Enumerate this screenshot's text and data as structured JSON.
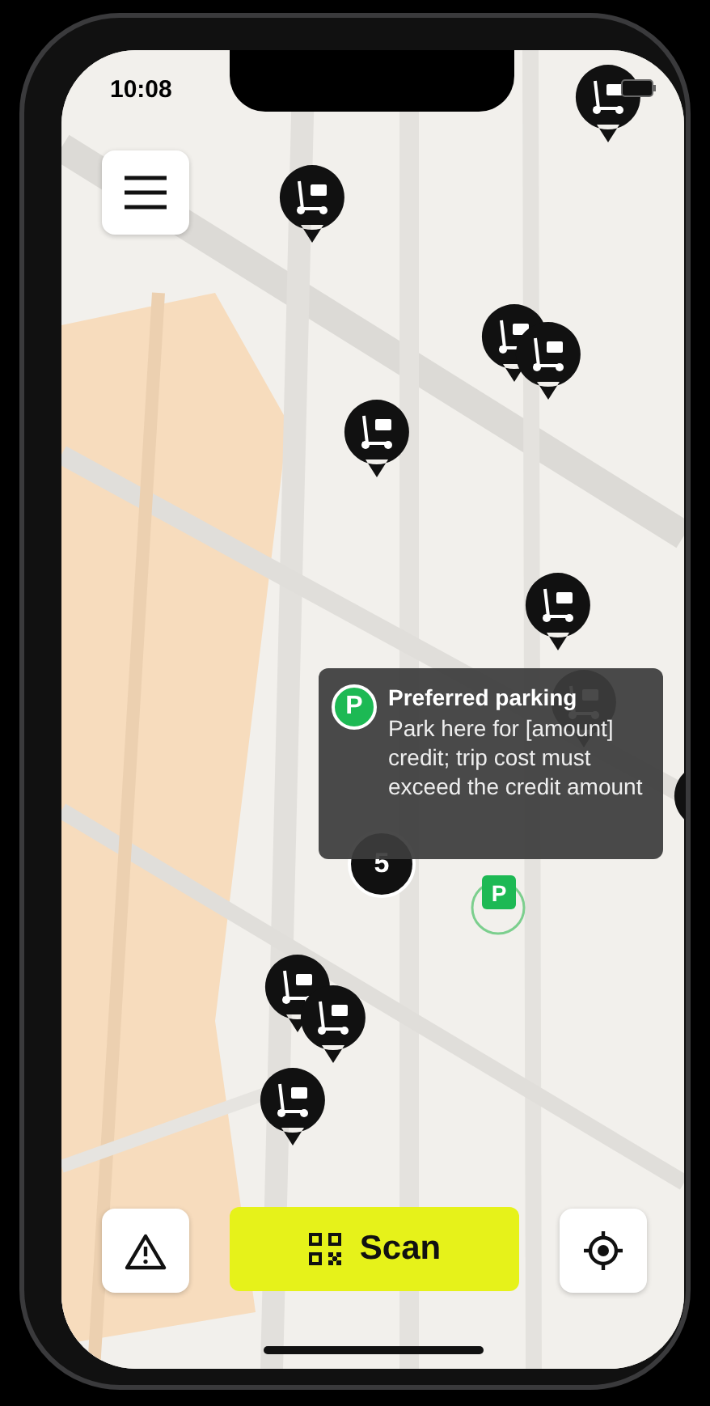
{
  "status_bar": {
    "time": "10:08"
  },
  "menu_button": {
    "kind": "menu"
  },
  "tooltip": {
    "badge": "P",
    "title": "Preferred parking",
    "text": "Park here for [amount] credit; trip cost must exceed the credit amount"
  },
  "cluster": {
    "count": "5"
  },
  "parking_marker": {
    "label": "P"
  },
  "toolbar": {
    "scan_label": "Scan"
  }
}
